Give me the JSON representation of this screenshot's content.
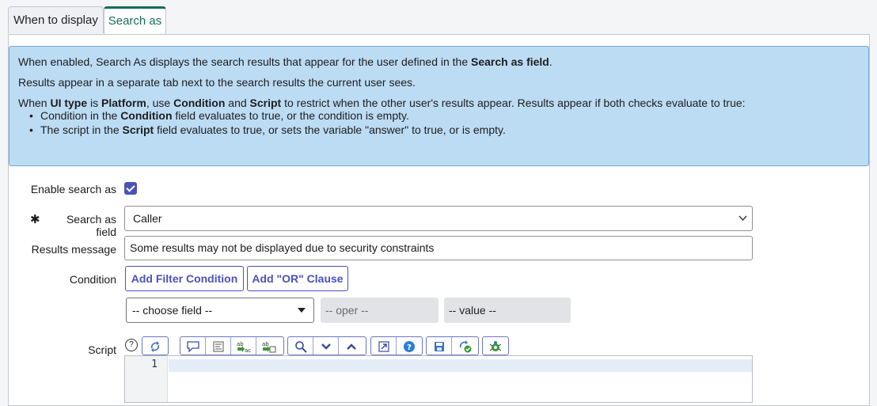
{
  "tabs": [
    {
      "label": "When to display"
    },
    {
      "label": "Search as"
    }
  ],
  "info": {
    "line1_pre": "When enabled, Search As displays the search results that appear for the user defined in the ",
    "line1_bold": "Search as field",
    "line1_post": ".",
    "line2": "Results appear in a separate tab next to the search results the current user sees.",
    "line3_a": "When ",
    "line3_b": "UI type",
    "line3_c": " is ",
    "line3_d": "Platform",
    "line3_e": ", use ",
    "line3_f": "Condition",
    "line3_g": " and ",
    "line3_h": "Script",
    "line3_i": " to restrict when the other user's results appear. Results appear if both checks evaluate to true:",
    "bullet1_a": "Condition in the ",
    "bullet1_b": "Condition",
    "bullet1_c": " field evaluates to true, or the condition is empty.",
    "bullet2_a": "The script in the ",
    "bullet2_b": "Script",
    "bullet2_c": " field evaluates to true, or sets the variable \"answer\" to true, or is empty."
  },
  "form": {
    "enable_label": "Enable search as",
    "enable_checked": true,
    "required_mark": "✱",
    "search_field_label": "Search as field",
    "search_field_value": "Caller",
    "results_label": "Results message",
    "results_value": "Some results may not be displayed due to security constraints",
    "condition_label": "Condition",
    "add_filter_label": "Add Filter Condition",
    "add_or_label": "Add \"OR\" Clause",
    "choose_field": "-- choose field --",
    "oper_placeholder": "-- oper --",
    "value_placeholder": "-- value --",
    "script_label": "Script",
    "line_number": "1"
  },
  "colors": {
    "accent": "#4b52b8",
    "tab_active": "#166c5a",
    "info_bg": "#bcdcf4"
  }
}
